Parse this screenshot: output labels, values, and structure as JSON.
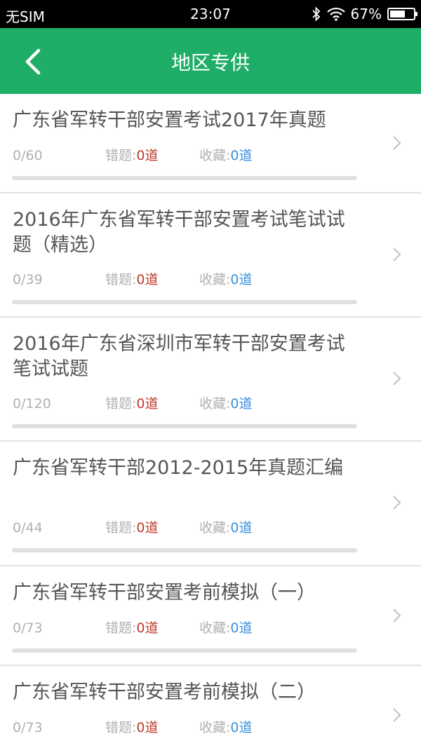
{
  "status_bar": {
    "carrier": "无SIM",
    "time": "23:07",
    "battery_percent": "67%",
    "battery_level": 0.67
  },
  "app_bar": {
    "title": "地区专供",
    "back_icon": "chevron-left-icon"
  },
  "exams": [
    {
      "title": "广东省军转干部安置考试2017年真题",
      "progress": "0/60",
      "done": 0,
      "total": 60,
      "wrong_label": "错题:",
      "wrong_count": "0道",
      "fav_label": "收藏:",
      "fav_count": "0道"
    },
    {
      "title": "2016年广东省军转干部安置考试笔试试题（精选）",
      "progress": "0/39",
      "done": 0,
      "total": 39,
      "wrong_label": "错题:",
      "wrong_count": "0道",
      "fav_label": "收藏:",
      "fav_count": "0道"
    },
    {
      "title": "2016年广东省深圳市军转干部安置考试笔试试题",
      "progress": "0/120",
      "done": 0,
      "total": 120,
      "wrong_label": "错题:",
      "wrong_count": "0道",
      "fav_label": "收藏:",
      "fav_count": "0道"
    },
    {
      "title": "广东省军转干部2012-2015年真题汇编",
      "progress": "0/44",
      "done": 0,
      "total": 44,
      "wrong_label": "错题:",
      "wrong_count": "0道",
      "fav_label": "收藏:",
      "fav_count": "0道"
    },
    {
      "title": "广东省军转干部安置考前模拟（一）",
      "progress": "0/73",
      "done": 0,
      "total": 73,
      "wrong_label": "错题:",
      "wrong_count": "0道",
      "fav_label": "收藏:",
      "fav_count": "0道"
    },
    {
      "title": "广东省军转干部安置考前模拟（二）",
      "progress": "0/73",
      "done": 0,
      "total": 73,
      "wrong_label": "错题:",
      "wrong_count": "0道",
      "fav_label": "收藏:",
      "fav_count": "0道"
    }
  ],
  "colors": {
    "primary": "#1fae67",
    "wrong": "#c0392b",
    "favorite": "#3a8edb",
    "muted": "#b0b0b0"
  }
}
